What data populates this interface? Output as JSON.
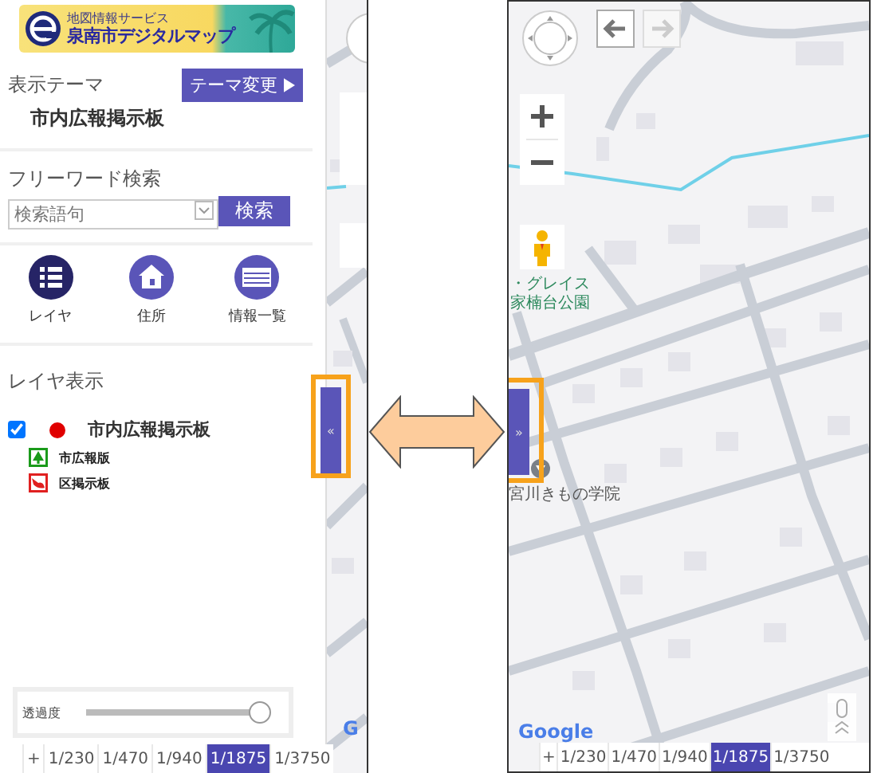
{
  "left_screen": {
    "logo": {
      "subtitle": "地図情報サービス",
      "title": "泉南市デジタルマップ"
    },
    "theme": {
      "label": "表示テーマ",
      "button": "テーマ変更",
      "value": "市内広報掲示板"
    },
    "search": {
      "label": "フリーワード検索",
      "placeholder": "検索語句",
      "button": "検索"
    },
    "nav": [
      {
        "kind": "list",
        "label": "レイヤ",
        "selected": true
      },
      {
        "kind": "house",
        "label": "住所",
        "selected": false
      },
      {
        "kind": "table",
        "label": "情報一覧",
        "selected": false
      }
    ],
    "layers": {
      "heading": "レイヤ表示",
      "items": [
        {
          "label": "市内広報掲示板",
          "checked": true,
          "color": "#e00000"
        }
      ],
      "legend": [
        {
          "kind": "tree",
          "label": "市広報版",
          "color": "#1a9a1a"
        },
        {
          "kind": "bird",
          "label": "区掲示板",
          "color": "#e02020"
        }
      ]
    },
    "opacity": {
      "label": "透過度",
      "level": 0.96
    },
    "collapse_button": "«",
    "map_logo": "G",
    "scale_bar": [
      {
        "label": "+",
        "selected": false
      },
      {
        "label": "1/230",
        "selected": false
      },
      {
        "label": "1/470",
        "selected": false
      },
      {
        "label": "1/940",
        "selected": false
      },
      {
        "label": "1/1875",
        "selected": true
      },
      {
        "label": "1/3750",
        "selected": false
      }
    ]
  },
  "right_screen": {
    "map_labels": [
      {
        "kind": "park",
        "label": "・グレイス"
      },
      {
        "kind": "park",
        "label": "家楠台公園"
      },
      {
        "kind": "place",
        "label": "宮川きもの学院"
      }
    ],
    "expand_button": "»",
    "map_logo": "Google",
    "scale_bar": [
      {
        "label": "+",
        "selected": false
      },
      {
        "label": "1/230",
        "selected": false
      },
      {
        "label": "1/470",
        "selected": false
      },
      {
        "label": "1/940",
        "selected": false
      },
      {
        "label": "1/1875",
        "selected": true
      },
      {
        "label": "1/3750",
        "selected": false
      }
    ]
  }
}
